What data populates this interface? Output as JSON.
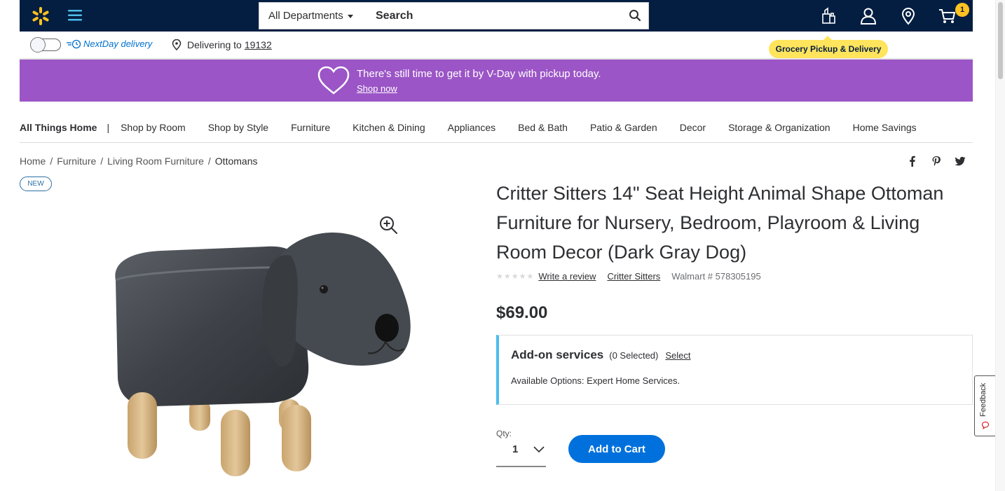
{
  "header": {
    "search": {
      "department": "All Departments",
      "placeholder": "Search"
    },
    "cart_count": "1",
    "tooltip": "Grocery Pickup & Delivery",
    "icons": [
      "walmart-spark-icon",
      "menu-icon",
      "search-icon",
      "grocery-icon",
      "account-icon",
      "location-icon",
      "cart-icon"
    ]
  },
  "subbar": {
    "nextday_label": "NextDay delivery",
    "delivering_prefix": "Delivering to",
    "zip": "19132"
  },
  "banner": {
    "text": "There's still time to get it by V-Day with pickup today.",
    "link": "Shop now"
  },
  "nav": {
    "first": "All Things Home",
    "separator": "|",
    "items": [
      "Shop by Room",
      "Shop by Style",
      "Furniture",
      "Kitchen & Dining",
      "Appliances",
      "Bed & Bath",
      "Patio & Garden",
      "Decor",
      "Storage & Organization",
      "Home Savings"
    ]
  },
  "breadcrumb": {
    "items": [
      "Home",
      "Furniture",
      "Living Room Furniture",
      "Ottomans"
    ],
    "sep": "/"
  },
  "product": {
    "badge": "NEW",
    "title": "Critter Sitters 14\" Seat Height Animal Shape Ottoman Furniture for Nursery, Bedroom, Playroom & Living Room Decor (Dark Gray Dog)",
    "rating": 0,
    "write_review": "Write a review",
    "brand": "Critter Sitters",
    "walmart_number": "Walmart # 578305195",
    "price": "$69.00"
  },
  "addon": {
    "title": "Add-on services",
    "selected": "(0 Selected)",
    "select_link": "Select",
    "options": "Available Options: Expert Home Services."
  },
  "purchase": {
    "qty_label": "Qty:",
    "qty_value": "1",
    "add_to_cart": "Add to Cart"
  },
  "feedback": "Feedback",
  "colors": {
    "header_bg": "#041e42",
    "spark": "#ffc220",
    "banner_bg": "#9b55c6",
    "primary_blue": "#0071dc",
    "addon_accent": "#4dbdeb"
  }
}
